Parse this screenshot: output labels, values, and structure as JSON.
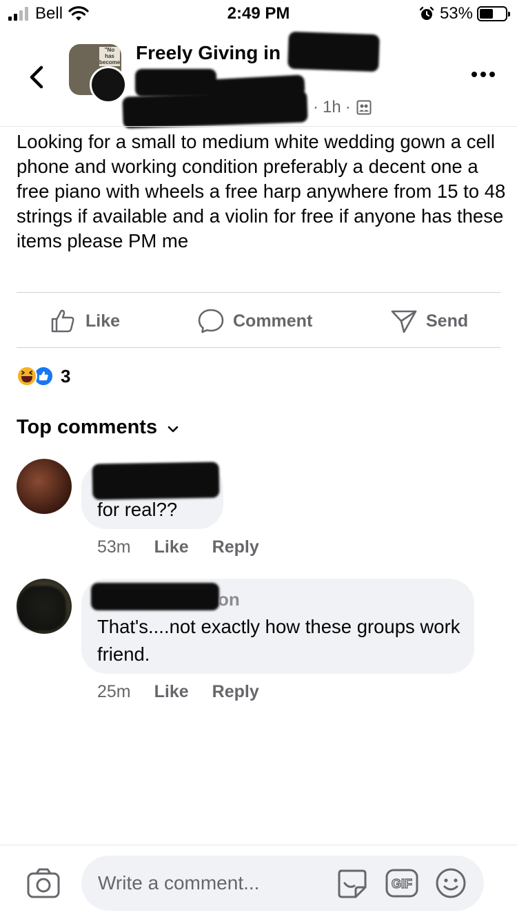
{
  "status_bar": {
    "carrier": "Bell",
    "time": "2:49 PM",
    "battery_percent": "53%"
  },
  "post": {
    "group_name": "Freely Giving in",
    "time_ago": "1h",
    "body": "Looking for a small to medium white wedding gown a cell phone and working condition preferably a decent one a free piano with wheels a free harp anywhere from 15 to 48 strings if available and a violin for free if anyone has these items please PM me",
    "avatar_sign_text": "\"No has become"
  },
  "actions": {
    "like_label": "Like",
    "comment_label": "Comment",
    "send_label": "Send"
  },
  "reactions": {
    "count": "3",
    "types": [
      "haha",
      "like"
    ]
  },
  "comments_section": {
    "title": "Top comments"
  },
  "comments": [
    {
      "text": "for real??",
      "time": "53m",
      "like_label": "Like",
      "reply_label": "Reply"
    },
    {
      "name_visible_fragment": "on",
      "text": "That's....not exactly how these groups work friend.",
      "time": "25m",
      "like_label": "Like",
      "reply_label": "Reply"
    }
  ],
  "composer": {
    "placeholder": "Write a comment...",
    "gif_label": "GIF"
  },
  "colors": {
    "text_primary": "#050505",
    "text_secondary": "#65676b",
    "bubble_bg": "#f0f2f5",
    "like_blue": "#1877f2",
    "haha_yellow": "#f7b125"
  }
}
